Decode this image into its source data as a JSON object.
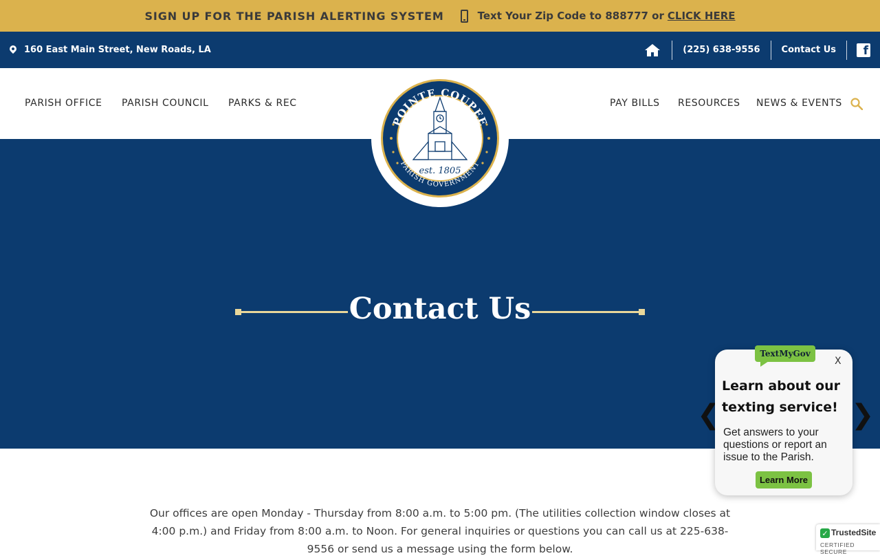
{
  "alert_bar": {
    "title": "SIGN UP FOR THE PARISH ALERTING SYSTEM",
    "text": "Text Your Zip Code to 888777 or",
    "link": "CLICK HERE",
    "icon": "mobile-phone-icon"
  },
  "utility_bar": {
    "address": "160 East Main Street, New Roads, LA",
    "phone": "(225) 638-9556",
    "contact": "Contact Us",
    "icons": [
      "map-pin-icon",
      "home-icon",
      "facebook-icon"
    ]
  },
  "nav": {
    "left": [
      "PARISH OFFICE",
      "PARISH COUNCIL",
      "PARKS & REC"
    ],
    "right": [
      "PAY BILLS",
      "RESOURCES",
      "NEWS & EVENTS"
    ],
    "search_icon": "search-icon"
  },
  "logo": {
    "top_text": "POINTE COUPEE",
    "bottom_text": "PARISH GOVERNMENT",
    "est": "est. 1805"
  },
  "hero": {
    "title": "Contact Us"
  },
  "body": {
    "intro": "Our offices are open Monday - Thursday from 8:00 a.m. to 5:00 pm. (The utilities collection window closes at 4:00 p.m.) and Friday from 8:00 a.m. to Noon. For general inquiries or questions you can call us at 225-638-9556 or send us a message using the form below."
  },
  "textmygov": {
    "badge": "TextMyGov",
    "close": "X",
    "heading": "Learn about our texting service!",
    "body": "Get answers to your questions or report an issue to the Parish.",
    "button": "Learn More"
  },
  "slider": {
    "prev": "❮",
    "next": "❯"
  },
  "trusted_site": {
    "name": "TrustedSite",
    "sub": "CERTIFIED SECURE"
  },
  "colors": {
    "navy": "#0c3b6f",
    "gold": "#dbb24d",
    "accent_line": "#e9d79a",
    "tmg_green": "#7cc243"
  }
}
